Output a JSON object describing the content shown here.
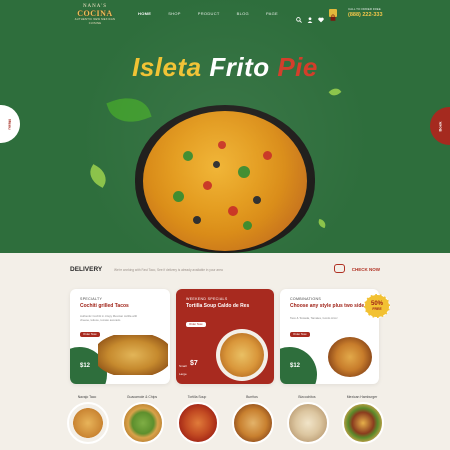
{
  "brand": {
    "name_top": "NANA'S",
    "name_main": "COCINA",
    "tagline": "AUTHENTIC NEW MEXICAN CUISINE"
  },
  "nav": {
    "items": [
      "HOME",
      "SHOP",
      "PRODUCT",
      "BLOG",
      "PAGE"
    ]
  },
  "header_icons": [
    "search-icon",
    "user-icon",
    "heart-icon",
    "cart-icon"
  ],
  "contact": {
    "label": "CALL TO ORDER FREE",
    "phone": "(888) 222-333"
  },
  "hero": {
    "title_part1": "Isleta",
    "title_part2": "Frito",
    "title_part3": "Pie",
    "left_tab": "Menu",
    "right_tab": "Book"
  },
  "delivery": {
    "heading": "DELIVERY",
    "description": "We're working with Fast Taco, See if delivery is already available in your area",
    "cta": "CHECK NOW"
  },
  "cards": [
    {
      "label": "SPECIALTY",
      "name": "Cochiti grilled Tacos",
      "description": "Authentic Cochiti in crispy Mexican tortilla with cheese, lettuce, tomato avocado",
      "button": "Order Now",
      "price": "$12"
    },
    {
      "label": "WEEKEND SPECIALS",
      "name": "Tortilla Soup Caldo de Res",
      "button": "Order Now",
      "price_label": "Small",
      "price": "$7",
      "size_label": "Large"
    },
    {
      "label": "COMBINATIONS",
      "name": "Choose any style plus two sides",
      "description": "Taco & Tostada, Tamales, Gordo Arroz",
      "button": "Order Now",
      "price": "$12"
    }
  ],
  "badge": {
    "line1": "50%",
    "line2": "FREE"
  },
  "categories": [
    "Navajo Taco",
    "Guacamole & Chips",
    "Tortilla Soup",
    "Burritos",
    "Bizcochitos",
    "Mexican Hamburger"
  ],
  "colors": {
    "hero_green": "#2e6e3c",
    "brand_red": "#a82a1f",
    "accent_yellow": "#f1c232",
    "page_bg": "#f3efe8"
  }
}
